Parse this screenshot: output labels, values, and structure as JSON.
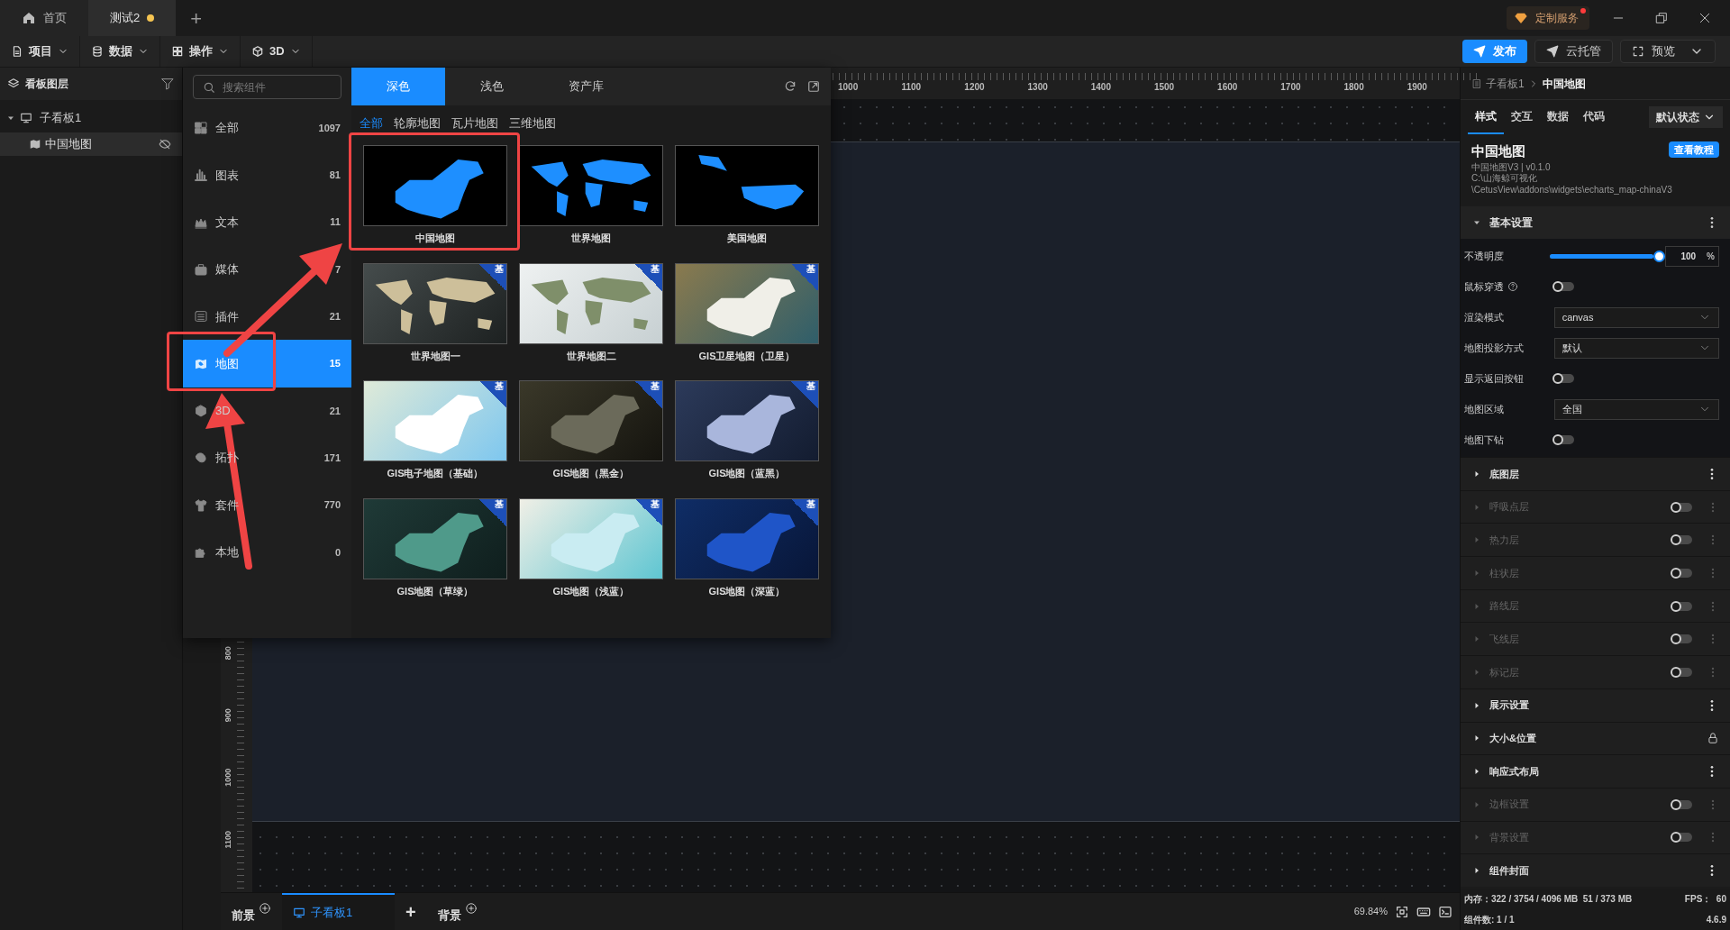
{
  "tabs": [
    {
      "label": "首页",
      "selected": false,
      "unsaved": false
    },
    {
      "label": "测试2",
      "selected": true,
      "unsaved": true
    }
  ],
  "new_tab": "+",
  "custom_service": "定制服务",
  "menu": [
    "项目",
    "数据",
    "操作",
    "3D"
  ],
  "actions": {
    "publish": "发布",
    "cloud": "云托管",
    "preview": "预览"
  },
  "layers_panel": {
    "title": "看板图层",
    "tree": [
      {
        "label": "子看板1",
        "expanded": true,
        "selected": false,
        "children": [
          {
            "label": "中国地图",
            "selected": true
          }
        ]
      }
    ]
  },
  "ruler": {
    "x_labels": [
      "1000",
      "1100",
      "1200",
      "1300",
      "1400",
      "1500",
      "1600",
      "1700",
      "1800",
      "1900"
    ],
    "y_labels": [
      "800",
      "900",
      "1000",
      "1100"
    ]
  },
  "component_panel": {
    "search": {
      "placeholder": "搜索组件"
    },
    "categories": [
      {
        "label": "全部",
        "count": "1097",
        "selected": false,
        "highlighted": false
      },
      {
        "label": "图表",
        "count": "81",
        "selected": false,
        "highlighted": false
      },
      {
        "label": "文本",
        "count": "11",
        "selected": false,
        "highlighted": false
      },
      {
        "label": "媒体",
        "count": "7",
        "selected": false,
        "highlighted": false
      },
      {
        "label": "插件",
        "count": "21",
        "selected": false,
        "highlighted": false
      },
      {
        "label": "地图",
        "count": "15",
        "selected": true,
        "highlighted": true
      },
      {
        "label": "3D",
        "count": "21",
        "selected": false,
        "highlighted": false
      },
      {
        "label": "拓扑",
        "count": "171",
        "selected": false,
        "highlighted": false
      },
      {
        "label": "套件",
        "count": "770",
        "selected": false,
        "highlighted": false
      },
      {
        "label": "本地",
        "count": "0",
        "selected": false,
        "highlighted": false
      }
    ],
    "theme_tabs": [
      {
        "label": "深色",
        "selected": true
      },
      {
        "label": "浅色",
        "selected": false
      },
      {
        "label": "资产库",
        "selected": false
      }
    ],
    "filters": [
      {
        "label": "全部",
        "selected": true
      },
      {
        "label": "轮廓地图",
        "selected": false
      },
      {
        "label": "瓦片地图",
        "selected": false
      },
      {
        "label": "三维地图",
        "selected": false
      }
    ],
    "cards": [
      {
        "label": "中国地图",
        "highlighted": true
      },
      {
        "label": "世界地图",
        "highlighted": false
      },
      {
        "label": "美国地图",
        "highlighted": false
      },
      {
        "label": "世界地图一",
        "badge": "基",
        "highlighted": false
      },
      {
        "label": "世界地图二",
        "badge": "基",
        "highlighted": false
      },
      {
        "label": "GIS卫星地图（卫星）",
        "badge": "基",
        "highlighted": false
      },
      {
        "label": "GIS电子地图（基础）",
        "badge": "基",
        "highlighted": false
      },
      {
        "label": "GIS地图（黑金）",
        "badge": "基",
        "highlighted": false
      },
      {
        "label": "GIS地图（蓝黑）",
        "badge": "基",
        "highlighted": false
      },
      {
        "label": "GIS地图（草绿）",
        "badge": "基",
        "highlighted": false
      },
      {
        "label": "GIS地图（浅蓝）",
        "badge": "基",
        "highlighted": false
      },
      {
        "label": "GIS地图（深蓝）",
        "badge": "基",
        "highlighted": false
      }
    ]
  },
  "bottom_bar": {
    "tabs": [
      {
        "label": "前景",
        "kind": "fixed",
        "selected": false
      },
      {
        "label": "子看板1",
        "kind": "board",
        "selected": true
      },
      {
        "label": "背景",
        "kind": "fixed",
        "selected": false
      }
    ],
    "add": "+",
    "zoom": "69.84%"
  },
  "inspector": {
    "breadcrumb": [
      "子看板1",
      "中国地图"
    ],
    "tabs": [
      {
        "label": "样式",
        "selected": true
      },
      {
        "label": "交互",
        "selected": false
      },
      {
        "label": "数据",
        "selected": false
      },
      {
        "label": "代码",
        "selected": false
      }
    ],
    "state": "默认状态",
    "title": "中国地图",
    "tutorial": "查看教程",
    "version": "中国地图V3 | v0.1.0",
    "path": [
      "C:\\山海鲸可视化",
      "\\CetusView\\addons\\widgets\\echarts_map-chinaV3"
    ],
    "basic": {
      "title": "基本设置",
      "expanded": true,
      "rows": [
        {
          "kind": "slider",
          "label": "不透明度",
          "level": 1,
          "value": "100",
          "unit": "%"
        },
        {
          "kind": "toggle",
          "label": "鼠标穿透",
          "help": true,
          "on": false
        },
        {
          "kind": "select",
          "label": "渲染模式",
          "value": "canvas"
        },
        {
          "kind": "select",
          "label": "地图投影方式",
          "value": "默认"
        },
        {
          "kind": "toggle",
          "label": "显示返回按钮",
          "help": false,
          "on": false
        },
        {
          "kind": "select",
          "label": "地图区域",
          "value": "全国"
        },
        {
          "kind": "toggle",
          "label": "地图下钻",
          "help": false,
          "on": false
        }
      ]
    },
    "sections": [
      {
        "label": "底图层",
        "kind": "menu"
      },
      {
        "label": "呼吸点层",
        "kind": "toggle",
        "on": false
      },
      {
        "label": "热力层",
        "kind": "toggle",
        "on": false
      },
      {
        "label": "柱状层",
        "kind": "toggle",
        "on": false
      },
      {
        "label": "路线层",
        "kind": "toggle",
        "on": false
      },
      {
        "label": "飞线层",
        "kind": "toggle",
        "on": false
      },
      {
        "label": "标记层",
        "kind": "toggle",
        "on": false
      },
      {
        "label": "展示设置",
        "kind": "menu"
      },
      {
        "label": "大小&位置",
        "kind": "lock"
      },
      {
        "label": "响应式布局",
        "kind": "menu"
      },
      {
        "label": "边框设置",
        "kind": "toggle",
        "on": false
      },
      {
        "label": "背景设置",
        "kind": "toggle",
        "on": false
      },
      {
        "label": "组件封面",
        "kind": "menu"
      }
    ],
    "status": {
      "memory": "内存：322 / 3754 / 4096 MB  51 / 373 MB",
      "fps": "FPS：  60",
      "count": "组件数: 1 / 1",
      "version": "4.6.9"
    }
  }
}
